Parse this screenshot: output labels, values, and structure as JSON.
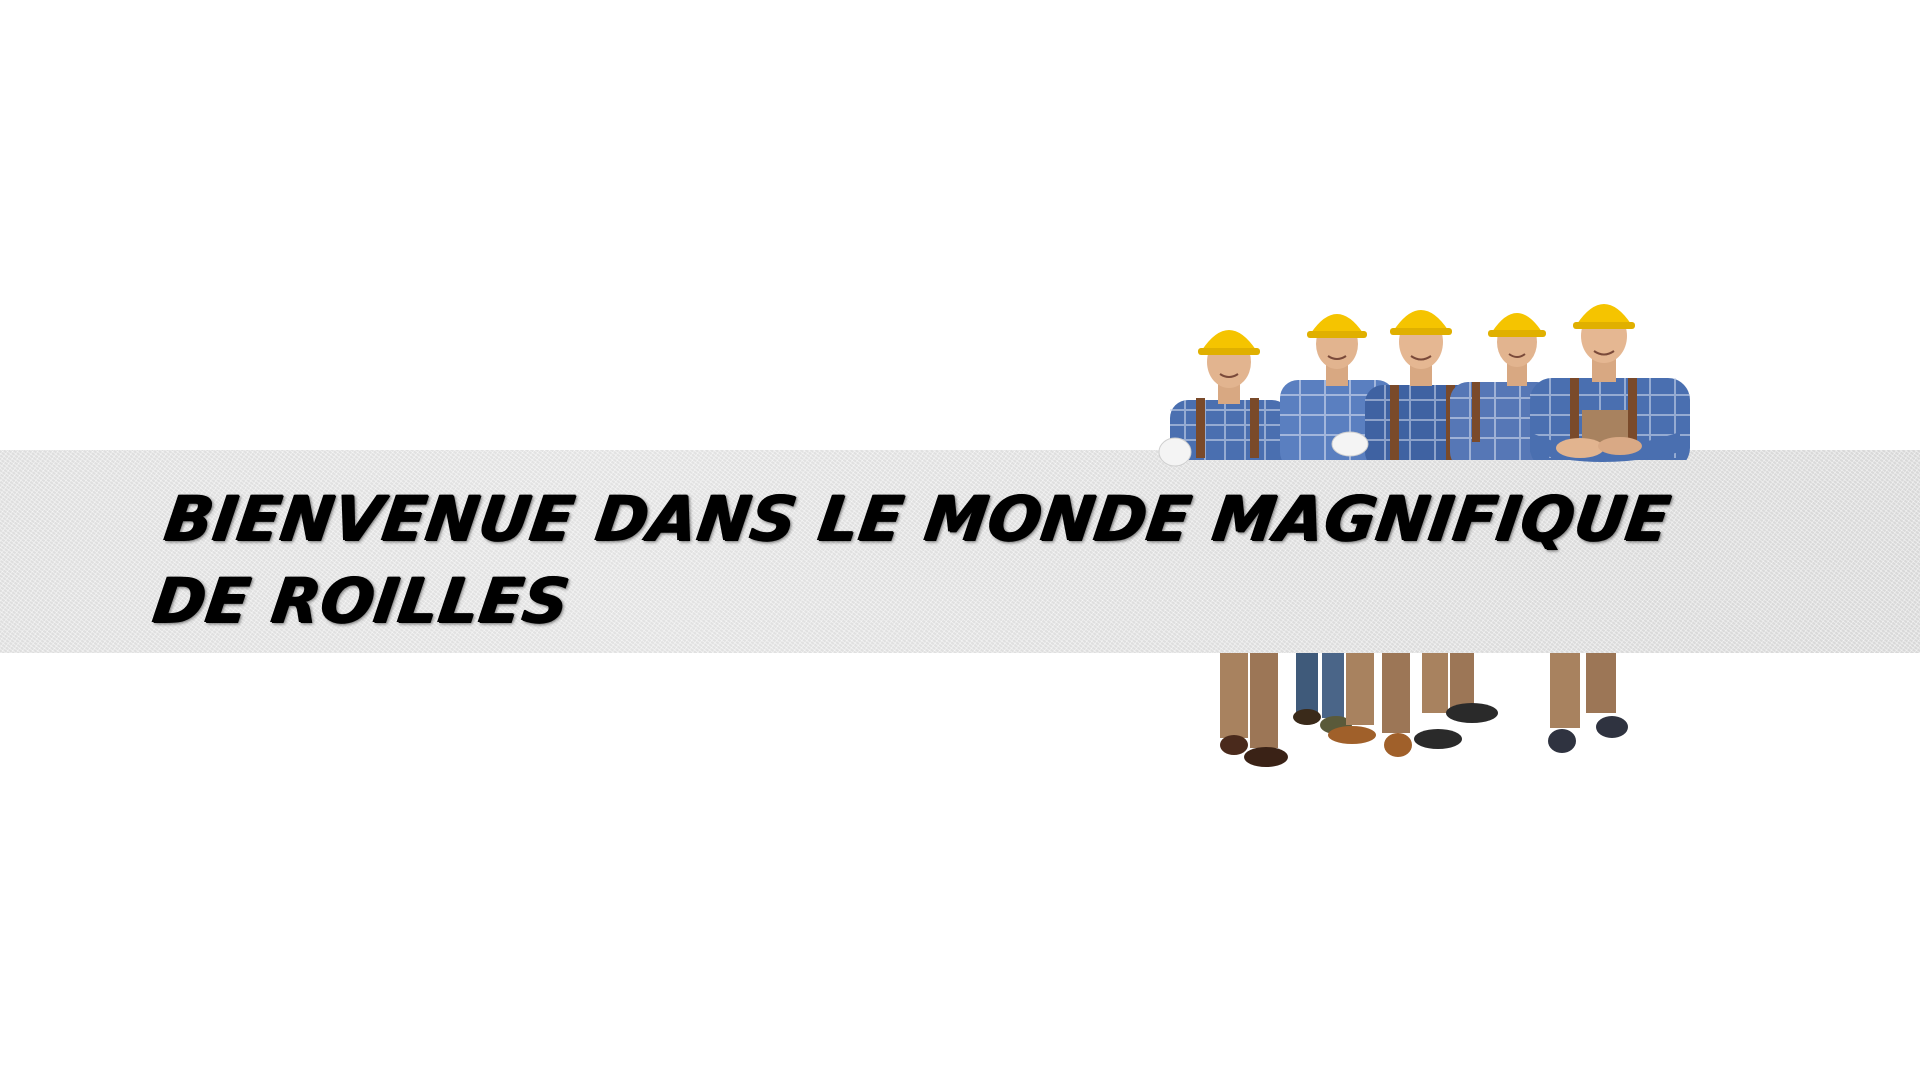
{
  "hero": {
    "headline": "Bienvenue dans le monde magnifique de Roilles"
  },
  "colors": {
    "page_background": "#ffffff",
    "banner": "#e9e9e9",
    "headline_text": "#000000",
    "helmet": "#f5c400",
    "shirt": "#4a6fb0",
    "overalls": "#a8825f",
    "strap": "#7a4a2a"
  },
  "illustration": {
    "icon": "construction-workers-illustration",
    "worker_count": 5
  }
}
